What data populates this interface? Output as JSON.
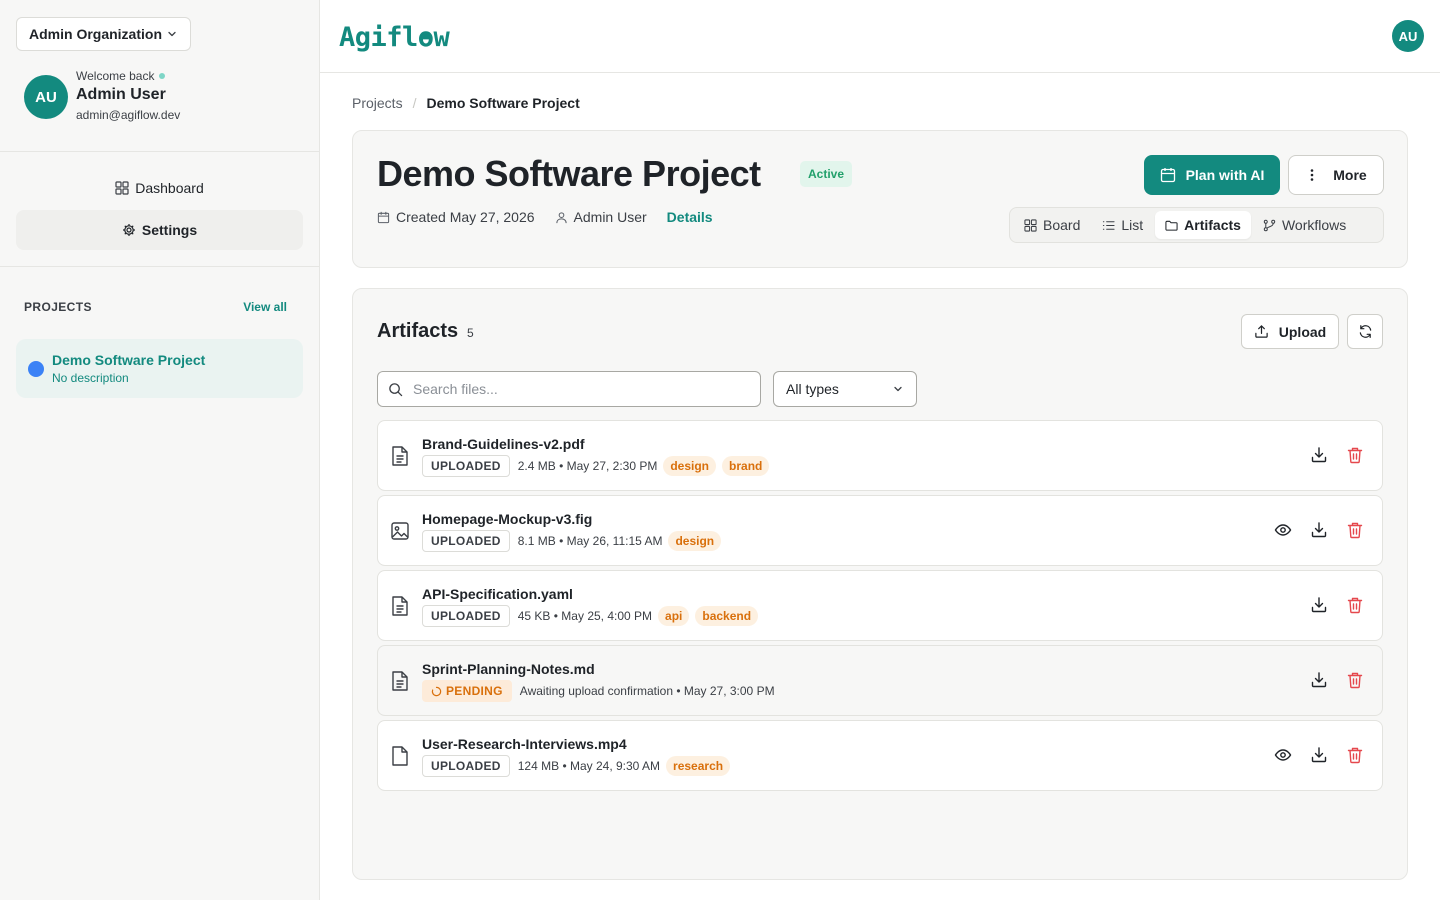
{
  "sidebar": {
    "org_label": "Admin Organization",
    "welcome": "Welcome back",
    "avatar_initials": "AU",
    "user_name": "Admin User",
    "user_email": "admin@agiflow.dev",
    "nav": [
      {
        "label": "Dashboard",
        "icon": "grid-icon"
      },
      {
        "label": "Settings",
        "icon": "gear-icon",
        "active": true
      }
    ],
    "projects_label": "PROJECTS",
    "view_all": "View all",
    "project": {
      "name": "Demo Software Project",
      "description": "No description",
      "color": "#3b82f6"
    }
  },
  "topbar": {
    "logo": "Agiflow",
    "avatar_initials": "AU"
  },
  "breadcrumb": {
    "root": "Projects",
    "current": "Demo Software Project"
  },
  "project": {
    "title": "Demo Software Project",
    "status": "Active",
    "created": "Created May 27, 2026",
    "owner": "Admin User",
    "details_link": "Details",
    "plan_button": "Plan with AI",
    "more_button": "More",
    "tabs": [
      {
        "label": "Board",
        "icon": "board-icon"
      },
      {
        "label": "List",
        "icon": "list-icon"
      },
      {
        "label": "Artifacts",
        "icon": "folder-icon",
        "active": true
      },
      {
        "label": "Workflows",
        "icon": "workflow-icon"
      }
    ]
  },
  "artifacts": {
    "title": "Artifacts",
    "count": "5",
    "upload_button": "Upload",
    "search_placeholder": "Search files...",
    "type_filter": "All types",
    "files": [
      {
        "name": "Brand-Guidelines-v2.pdf",
        "status": "UPLOADED",
        "info": "2.4 MB • May 27, 2:30 PM",
        "tags": [
          "design",
          "brand"
        ],
        "icon": "document-icon",
        "preview": false
      },
      {
        "name": "Homepage-Mockup-v3.fig",
        "status": "UPLOADED",
        "info": "8.1 MB • May 26, 11:15 AM",
        "tags": [
          "design"
        ],
        "icon": "image-icon",
        "preview": true
      },
      {
        "name": "API-Specification.yaml",
        "status": "UPLOADED",
        "info": "45 KB • May 25, 4:00 PM",
        "tags": [
          "api",
          "backend"
        ],
        "icon": "document-icon",
        "preview": false
      },
      {
        "name": "Sprint-Planning-Notes.md",
        "status": "PENDING",
        "info": "Awaiting upload confirmation • May 27, 3:00 PM",
        "tags": [],
        "icon": "document-icon",
        "preview": false
      },
      {
        "name": "User-Research-Interviews.mp4",
        "status": "UPLOADED",
        "info": "124 MB • May 24, 9:30 AM",
        "tags": [
          "research"
        ],
        "icon": "file-icon",
        "preview": true
      }
    ]
  },
  "colors": {
    "brand": "#138a7f",
    "accent_tag": "#d9700c",
    "delete": "#e5484d"
  }
}
